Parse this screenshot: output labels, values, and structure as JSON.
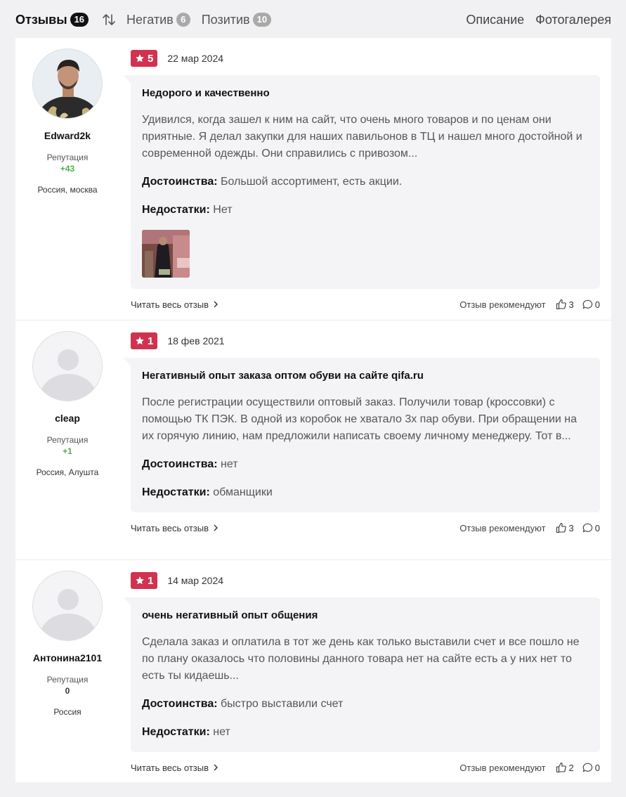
{
  "tabs": {
    "reviews_label": "Отзывы",
    "reviews_count": "16",
    "negative_label": "Негатив",
    "negative_count": "6",
    "positive_label": "Позитив",
    "positive_count": "10",
    "description_label": "Описание",
    "gallery_label": "Фотогалерея"
  },
  "colors": {
    "rating_badge": "#d0324f",
    "reputation_positive": "#4caf50"
  },
  "reviews": [
    {
      "author": "Edward2k",
      "reputation_label": "Репутация",
      "reputation": "+43",
      "location": "Россия, москва",
      "rating": "5",
      "date": "22 мар 2024",
      "title": "Недорого и качественно",
      "text": "Удивился, когда зашел к ним на сайт, что очень много товаров и по ценам они приятные. Я делал закупки для наших павильонов в ТЦ и нашел много достойной и современной одежды. Они справились с привозом...",
      "pros_label": "Достоинства:",
      "pros": "Большой ассортимент, есть акции.",
      "cons_label": "Недостатки:",
      "cons": "Нет",
      "read_more": "Читать весь отзыв",
      "recommend_label": "Отзыв рекомендуют",
      "likes": "3",
      "comments": "0"
    },
    {
      "author": "cleap",
      "reputation_label": "Репутация",
      "reputation": "+1",
      "location": "Россия, Алушта",
      "rating": "1",
      "date": "18 фев 2021",
      "title": "Негативный опыт заказа оптом обуви на сайте qifa.ru",
      "text": "После регистрации осуществили оптовый заказ. Получили товар (кроссовки) с помощью ТК ПЭК. В одной из коробок не хватало 3х пар обуви. При обращении на их горячую линию, нам предложили написать своему личному менеджеру. Тот в...",
      "pros_label": "Достоинства:",
      "pros": "нет",
      "cons_label": "Недостатки:",
      "cons": "обманщики",
      "read_more": "Читать весь отзыв",
      "recommend_label": "Отзыв рекомендуют",
      "likes": "3",
      "comments": "0"
    },
    {
      "author": "Антонина2101",
      "reputation_label": "Репутация",
      "reputation": "0",
      "location": "Россия",
      "rating": "1",
      "date": "14 мар 2024",
      "title": "очень негативный опыт общения",
      "text": "Сделала заказ и оплатила в тот же день как только выставили счет и все пошло не по плану оказалось что половины данного товара нет на сайте есть а у них нет то есть ты кидаешь...",
      "pros_label": "Достоинства:",
      "pros": "быстро выставили счет",
      "cons_label": "Недостатки:",
      "cons": "нет",
      "read_more": "Читать весь отзыв",
      "recommend_label": "Отзыв рекомендуют",
      "likes": "2",
      "comments": "0"
    }
  ]
}
